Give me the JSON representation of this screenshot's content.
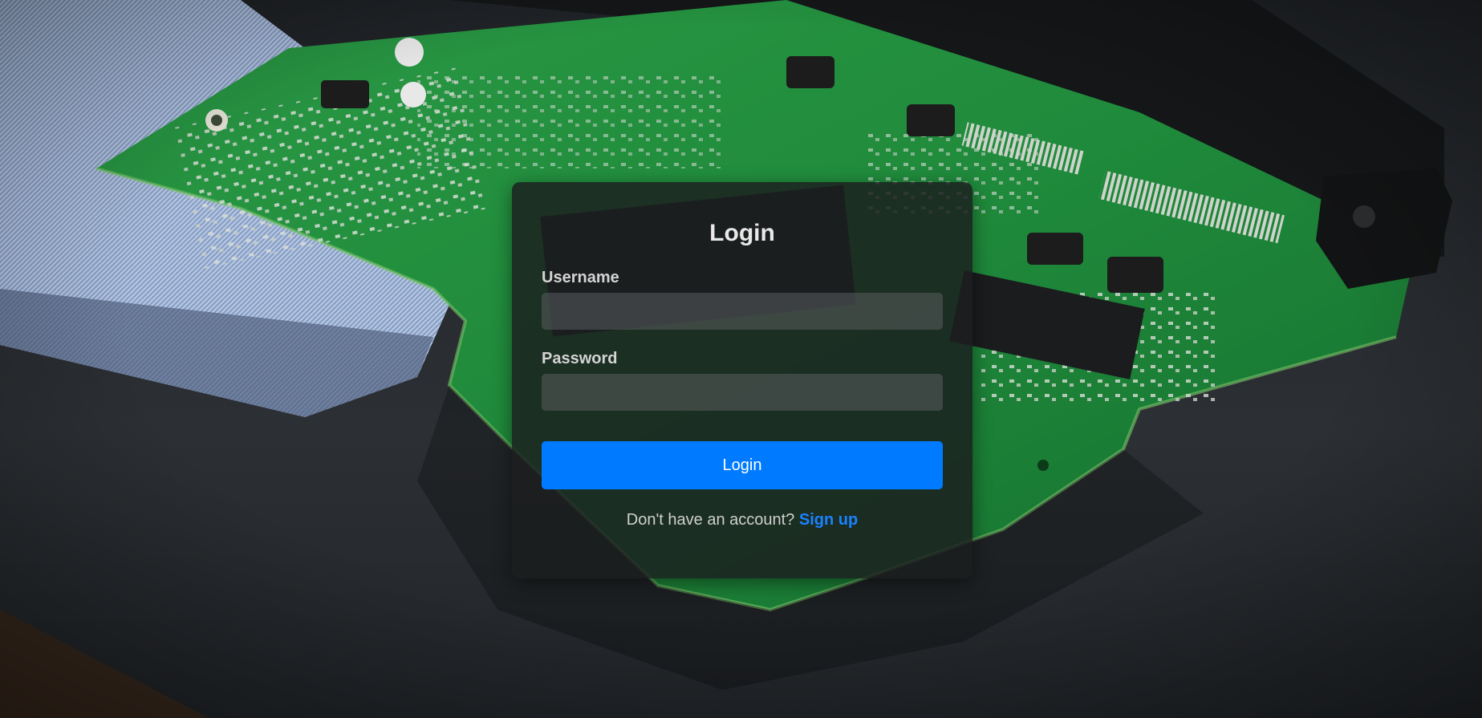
{
  "login": {
    "title": "Login",
    "username_label": "Username",
    "username_value": "",
    "password_label": "Password",
    "password_value": "",
    "submit_label": "Login",
    "signup_prompt": "Don't have an account?",
    "signup_link": "Sign up"
  },
  "colors": {
    "accent": "#007bff",
    "link": "#1a82ff",
    "card_background": "#1c1e1f",
    "pcb_green": "#1f8a3b"
  },
  "background": {
    "subject": "circuit-board-photo"
  }
}
